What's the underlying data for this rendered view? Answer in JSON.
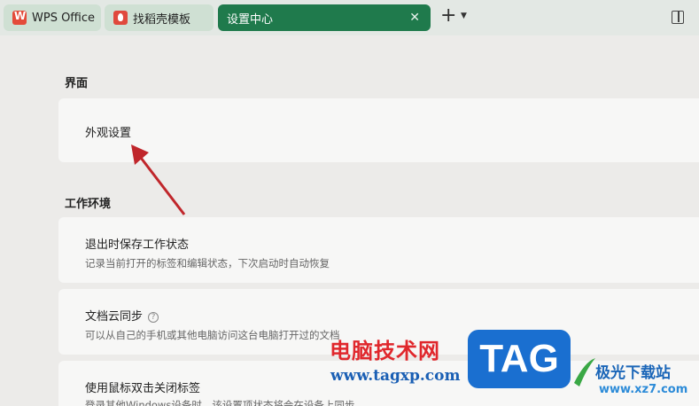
{
  "tabs": [
    {
      "label": "WPS Office"
    },
    {
      "label": "找稻壳模板"
    },
    {
      "label": "设置中心"
    }
  ],
  "sections": {
    "interface": {
      "title": "界面",
      "items": [
        {
          "title": "外观设置"
        }
      ]
    },
    "work_env": {
      "title": "工作环境",
      "items": [
        {
          "title": "退出时保存工作状态",
          "desc": "记录当前打开的标签和编辑状态，下次启动时自动恢复"
        },
        {
          "title": "文档云同步",
          "desc": "可以从自己的手机或其他电脑访问这台电脑打开过的文档"
        },
        {
          "title": "使用鼠标双击关闭标签",
          "desc": "登录其他Windows设备时，该设置项状态将会在设备上同步"
        }
      ]
    }
  },
  "watermark": {
    "cn": "电脑技术网",
    "url": "www.tagxp.com",
    "tag": "TAG",
    "site_cn": "极光下载站",
    "site_url": "www.xz7.com"
  },
  "colors": {
    "accent": "#1f7a4c",
    "arrow": "#c0262b"
  }
}
